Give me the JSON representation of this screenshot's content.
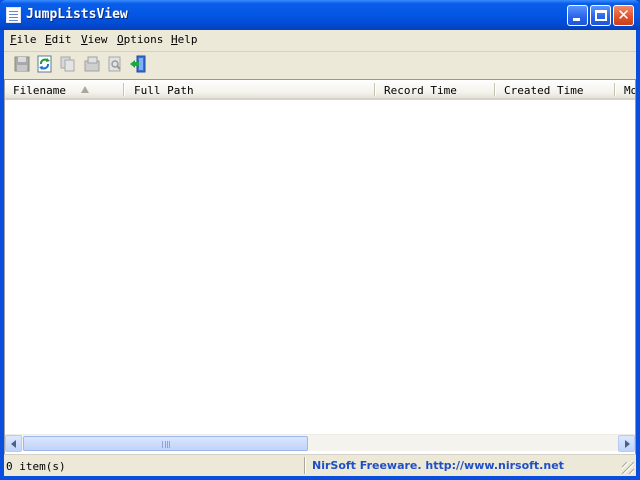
{
  "window": {
    "title": "JumpListsView"
  },
  "menubar": {
    "items": [
      {
        "accel": "F",
        "rest": "ile"
      },
      {
        "accel": "E",
        "rest": "dit"
      },
      {
        "accel": "V",
        "rest": "iew"
      },
      {
        "accel": "O",
        "rest": "ptions"
      },
      {
        "accel": "H",
        "rest": "elp"
      }
    ]
  },
  "toolbar": {
    "icons": [
      "save-icon",
      "refresh-icon",
      "copy-icon",
      "properties-icon",
      "find-icon",
      "exit-icon"
    ]
  },
  "table": {
    "columns": [
      {
        "label": "Filename",
        "sorted": "ascending"
      },
      {
        "label": "Full Path"
      },
      {
        "label": "Record Time"
      },
      {
        "label": "Created Time"
      },
      {
        "label": "Mo"
      }
    ],
    "rows": []
  },
  "statusbar": {
    "count": "0 item(s)",
    "credit": "NirSoft Freeware.  http://www.nirsoft.net"
  },
  "colors": {
    "titlebar": "#0355e4",
    "link": "#1f4fc8",
    "chrome": "#ece9d8"
  }
}
